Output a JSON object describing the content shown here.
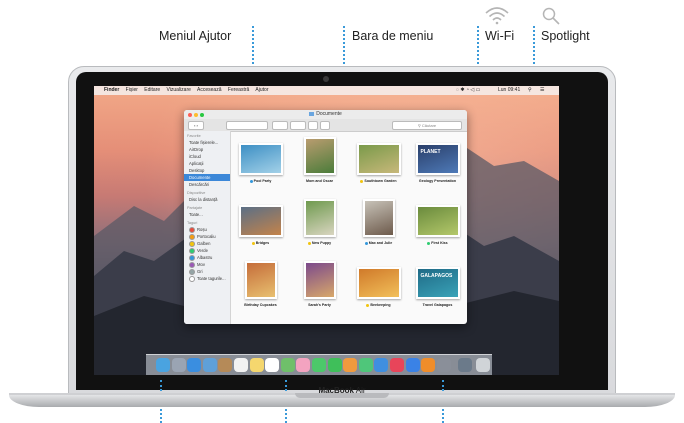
{
  "callouts": {
    "help_menu": "Meniul Ajutor",
    "menu_bar": "Bara de meniu",
    "wifi": "Wi-Fi",
    "spotlight": "Spotlight"
  },
  "laptop": {
    "brand_bold": "MacBook",
    "brand_light": " Air"
  },
  "menubar": {
    "apple": "",
    "items": [
      "Finder",
      "Fișier",
      "Editare",
      "Vizualizare",
      "Accesează",
      "Fereastră",
      "Ajutor"
    ],
    "clock": "Lun 09:41"
  },
  "finder": {
    "title": "Documente",
    "search_placeholder": "Căutare",
    "sidebar": {
      "favorites_header": "Favorite",
      "favorites": [
        "Toate fișierele...",
        "AirDrop",
        "iCloud",
        "Aplicații",
        "Desktop",
        "Documente",
        "Descărcări"
      ],
      "selected": "Documente",
      "devices_header": "Dispozitive",
      "devices": [
        "Disc la distanță"
      ],
      "shared_header": "Partajate",
      "shared": [
        "Toate..."
      ],
      "tags_header": "Taguri",
      "tags": [
        {
          "label": "Roșu",
          "color": "#e74c3c"
        },
        {
          "label": "Portocaliu",
          "color": "#f39c12"
        },
        {
          "label": "Galben",
          "color": "#f1c40f"
        },
        {
          "label": "Verde",
          "color": "#2ecc71"
        },
        {
          "label": "Albastru",
          "color": "#3498db"
        },
        {
          "label": "Mov",
          "color": "#9b59b6"
        },
        {
          "label": "Gri",
          "color": "#95a5a6"
        },
        {
          "label": "Toate tagurile...",
          "color": "#ffffff"
        }
      ]
    },
    "files": [
      {
        "name": "Pool Party",
        "tag": "#3498db"
      },
      {
        "name": "Mom and Oscar",
        "tag": ""
      },
      {
        "name": "Southtown Garden",
        "tag": "#f1c40f"
      },
      {
        "name": "Geology Presentation",
        "tag": ""
      },
      {
        "name": "Bridges",
        "tag": "#f1c40f"
      },
      {
        "name": "New Puppy",
        "tag": "#f1c40f"
      },
      {
        "name": "Max and Julie",
        "tag": "#3498db"
      },
      {
        "name": "First Kiss",
        "tag": "#2ecc71"
      },
      {
        "name": "Birthday Cupcakes",
        "tag": ""
      },
      {
        "name": "Sarah's Party",
        "tag": ""
      },
      {
        "name": "Beekeeping",
        "tag": "#f1c40f"
      },
      {
        "name": "Travel Galapagos",
        "tag": ""
      }
    ],
    "overlay_text": {
      "geology": "PLANET",
      "galapagos": "GALAPAGOS"
    }
  },
  "dock_icons": [
    "finder-icon",
    "launchpad-icon",
    "safari-icon",
    "mail-icon",
    "contacts-icon",
    "calendar-icon",
    "notes-icon",
    "reminders-icon",
    "maps-icon",
    "photos-icon",
    "messages-icon",
    "facetime-icon",
    "pages-icon",
    "numbers-icon",
    "keynote-icon",
    "itunes-icon",
    "app-store-icon",
    "ibooks-icon",
    "system-preferences-icon",
    "downloads-stack-icon",
    "trash-icon"
  ],
  "colors": {
    "callout_dots": "#3a9ad9",
    "selection": "#3b87d8"
  }
}
